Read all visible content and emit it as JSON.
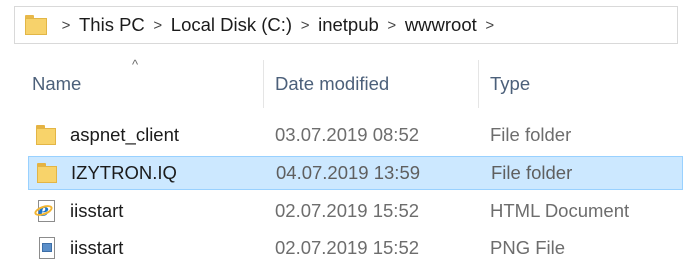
{
  "address_bar": {
    "crumbs": [
      "This PC",
      "Local Disk (C:)",
      "inetpub",
      "wwwroot"
    ],
    "separator": ">"
  },
  "columns": {
    "name": "Name",
    "date_modified": "Date modified",
    "type": "Type",
    "sort_indicator": "^"
  },
  "files": [
    {
      "name": "aspnet_client",
      "date": "03.07.2019 08:52",
      "type": "File folder",
      "icon": "folder-icon",
      "selected": false
    },
    {
      "name": "IZYTRON.IQ",
      "date": "04.07.2019 13:59",
      "type": "File folder",
      "icon": "folder-icon",
      "selected": true
    },
    {
      "name": "iisstart",
      "date": "02.07.2019 15:52",
      "type": "HTML Document",
      "icon": "html-document-icon",
      "selected": false
    },
    {
      "name": "iisstart",
      "date": "02.07.2019 15:52",
      "type": "PNG File",
      "icon": "png-file-icon",
      "selected": false
    }
  ],
  "colors": {
    "selection_fill": "#cce8ff",
    "selection_border": "#99d1ff",
    "folder": "#f8d36a",
    "header_text": "#4c607a"
  }
}
